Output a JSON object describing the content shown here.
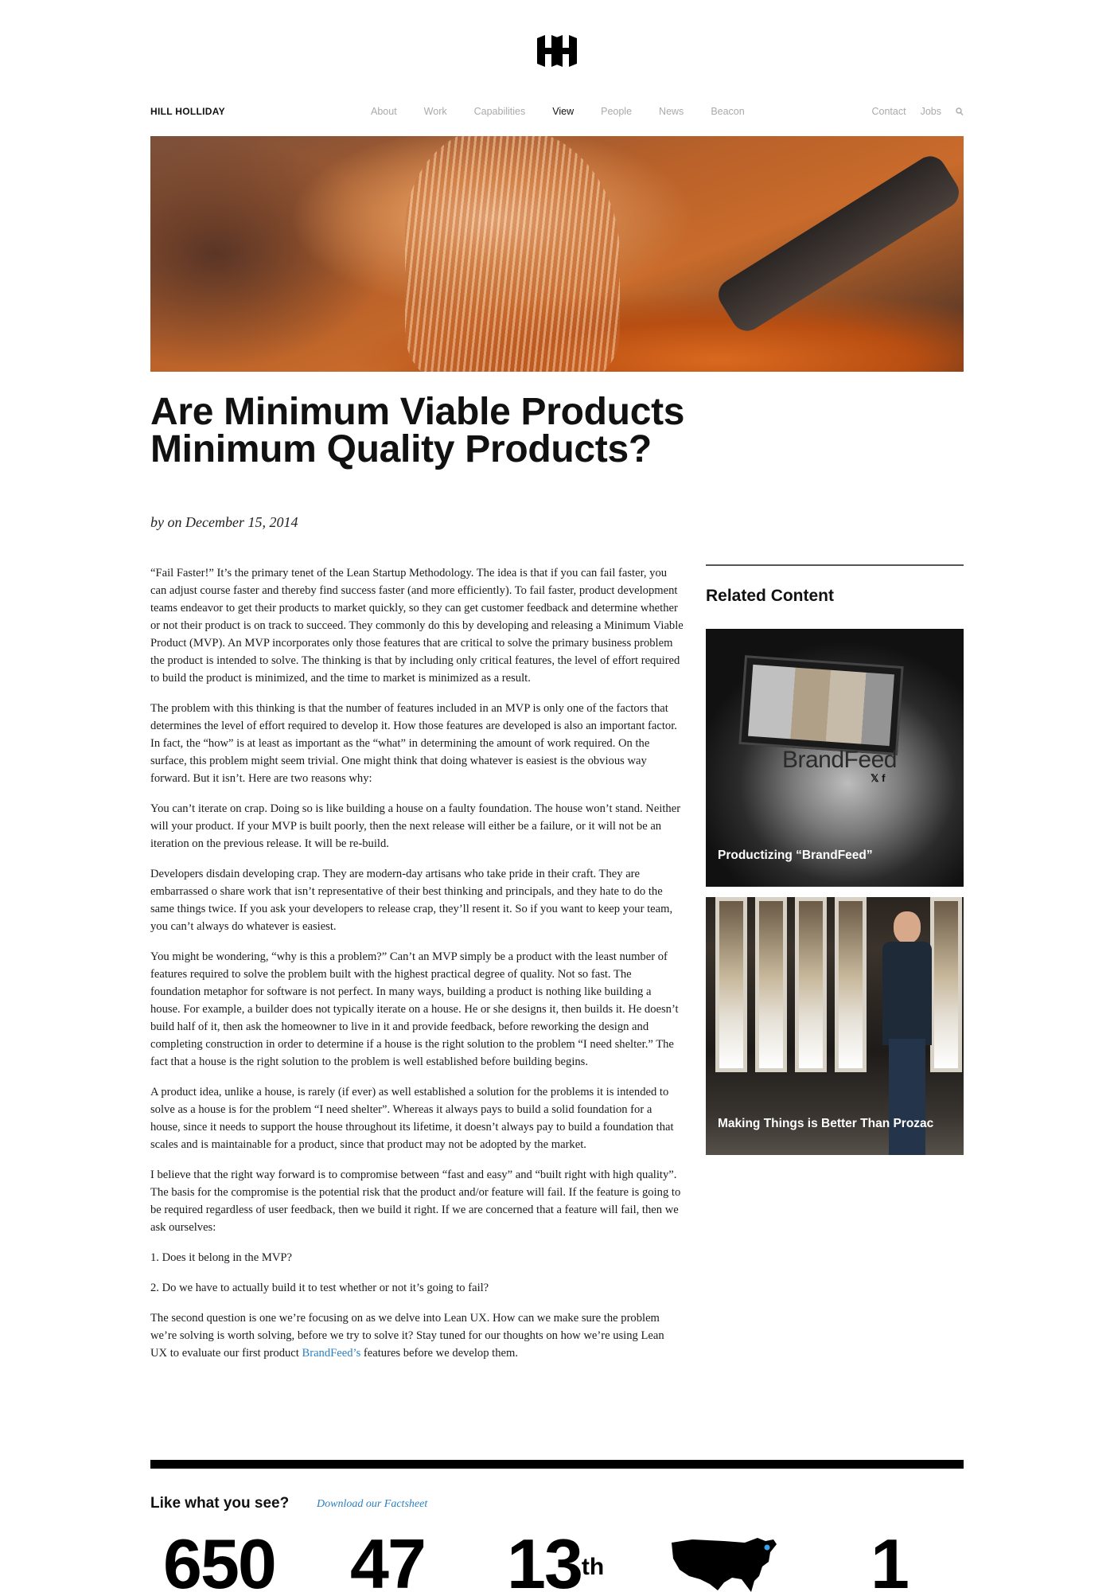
{
  "header": {
    "brand": "HILL HOLLIDAY",
    "nav_center": [
      "About",
      "Work",
      "Capabilities",
      "View",
      "People",
      "News",
      "Beacon"
    ],
    "active": "View",
    "nav_right": [
      "Contact",
      "Jobs"
    ],
    "search_icon": "search-icon"
  },
  "article": {
    "title": "Are Minimum Viable Products Minimum Quality Products?",
    "byline": "by on December 15, 2014",
    "paragraphs": [
      "“Fail Faster!” It’s the primary tenet of the Lean Startup Methodology. The idea is that if you can fail faster, you can adjust course faster and thereby find success faster (and more efficiently). To fail faster, product development teams endeavor to get their products to market quickly, so they can get customer feedback and determine whether or not their product is on track to succeed. They commonly do this by developing and releasing a Minimum Viable Product (MVP). An MVP incorporates only those features that are critical to solve the primary business problem the product is intended to solve. The thinking is that by including only critical features, the level of effort required to build the product is minimized, and the time to market is minimized as a result.",
      "The problem with this thinking is that the number of features included in an MVP is only one of the factors that determines the level of effort required to develop it. How those features are developed is also an important factor. In fact, the “how” is at least as important as the “what” in determining the amount of work required. On the surface, this problem might seem trivial. One might think that doing whatever is easiest is the obvious way forward. But it isn’t. Here are two reasons why:",
      "You can’t iterate on crap. Doing so is like building a house on a faulty foundation. The house won’t stand. Neither will your product. If your MVP is built poorly, then the next release will either be a failure, or it will not be an iteration on the previous release. It will be re-build.",
      "Developers disdain developing crap. They are modern-day artisans who take pride in their craft. They are embarrassed o share work that isn’t representative of their best thinking and principals, and they hate to do the same things twice. If you ask your developers to release crap, they’ll resent it. So if you want to keep your team, you can’t always do whatever is easiest.",
      "You might be wondering, “why is this a problem?” Can’t an MVP simply be a product with the least number of features required to solve the problem built with the highest practical degree of quality. Not so fast. The foundation metaphor for software is not perfect. In many ways, building a product is nothing like building a house. For example, a builder does not typically iterate on a house. He or she designs it, then builds it. He doesn’t build half of it, then ask the homeowner to live in it and provide feedback, before reworking the design and completing construction in order to determine if a house is the right solution to the problem “I need shelter.” The fact that a house is the right solution to the problem is well established before building begins.",
      "A product idea, unlike a house, is rarely (if ever) as well established a solution for the problems it is intended to solve as a house is for the problem “I need shelter”. Whereas it always pays to build a solid foundation for a house, since it needs to support the house throughout its lifetime, it doesn’t always pay to build a foundation that scales and is maintainable for a product, since that product may not be adopted by the market.",
      "I believe that the right way forward is to compromise between “fast and easy” and “built right with high quality”. The basis for the compromise is the potential risk that the product and/or feature will fail. If the feature is going to be required regardless of user feedback, then we build it right. If we are concerned that a feature will fail, then we ask ourselves:",
      "1. Does it belong in the MVP?",
      "2. Do we have to actually build it to test whether or not it’s going to fail?"
    ],
    "last_paragraph_before": "The second question is one we’re focusing on as we delve into Lean UX. How can we make sure the problem we’re solving is worth solving, before we try to solve it? Stay tuned for our thoughts on how we’re using Lean UX to evaluate our first product ",
    "last_paragraph_link": "BrandFeed’s",
    "last_paragraph_after": " features before we develop them."
  },
  "sidebar": {
    "title": "Related Content",
    "cards": [
      {
        "caption": "Productizing “BrandFeed”",
        "logo_text": "BrandFeed",
        "social": "𝕏 f"
      },
      {
        "caption": "Making Things is Better Than Prozac"
      }
    ]
  },
  "footer": {
    "like": "Like what you see?",
    "download": "Download our Factsheet",
    "stats": [
      "650",
      "47",
      "13",
      "1"
    ],
    "stat_suffix": "th"
  }
}
